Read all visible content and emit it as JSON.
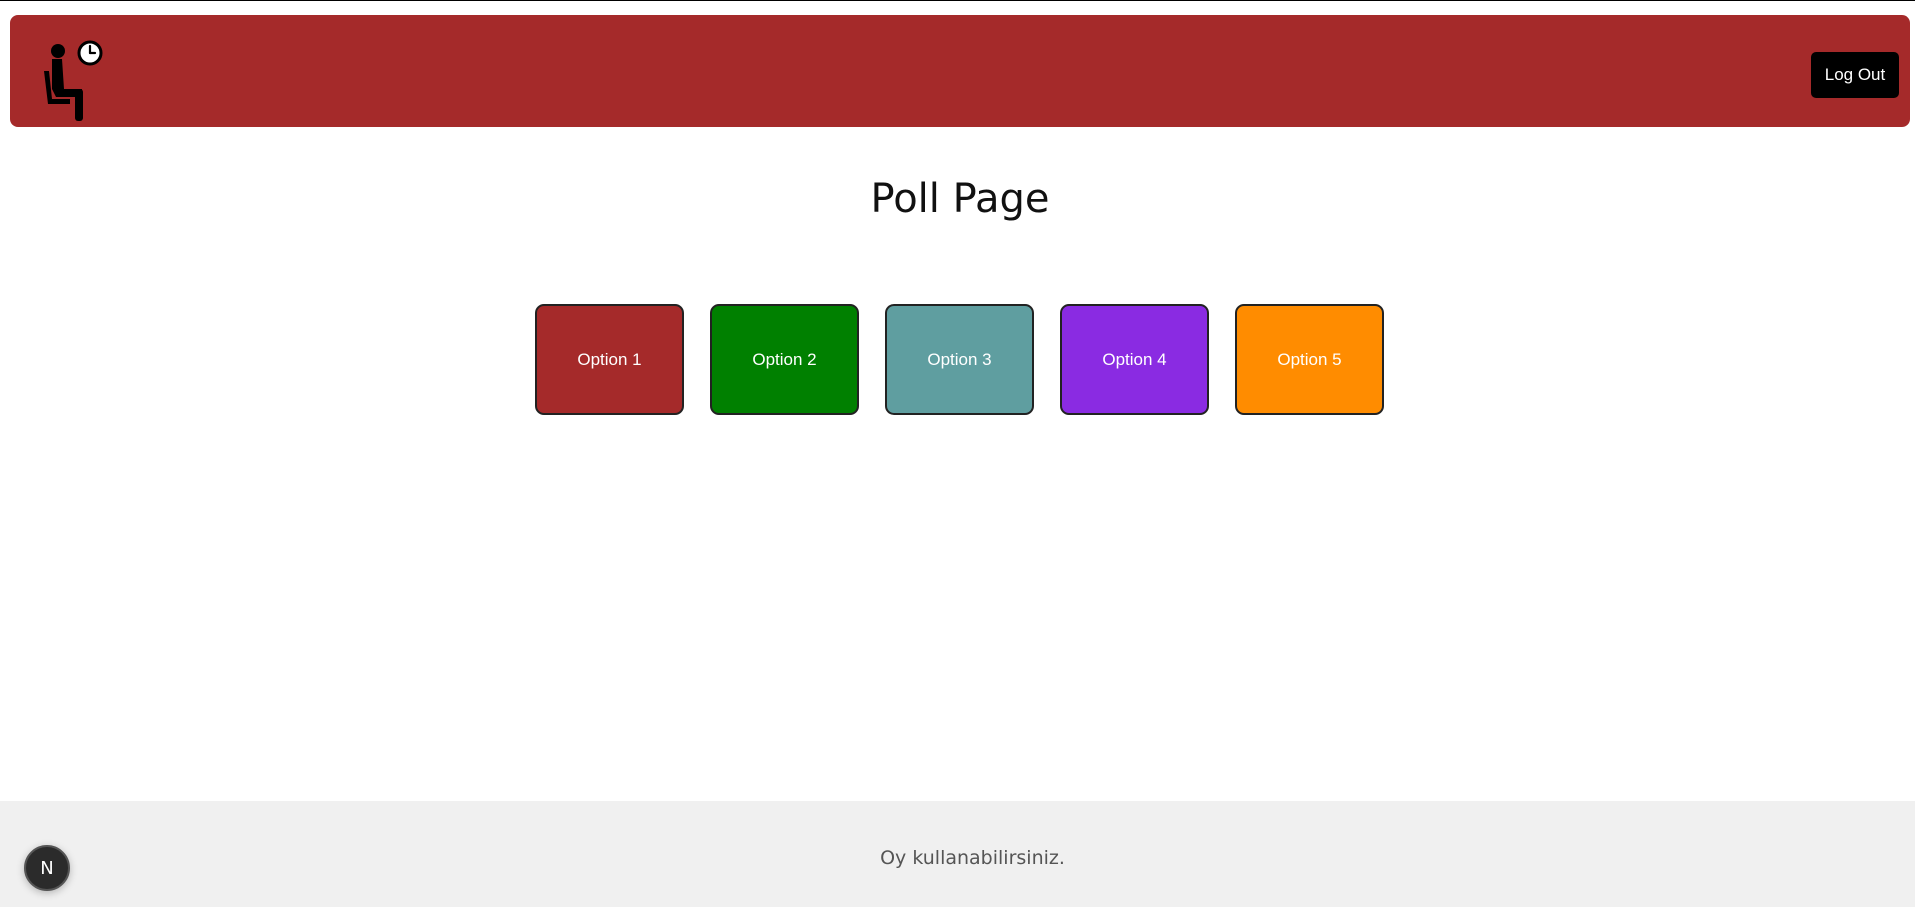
{
  "header": {
    "logo_icon": "waiting-person-with-clock-icon",
    "logout_label": "Log Out",
    "background": "#a52a2a"
  },
  "main": {
    "title": "Poll Page",
    "options": [
      {
        "label": "Option 1",
        "color": "#a52a2a"
      },
      {
        "label": "Option 2",
        "color": "#008000"
      },
      {
        "label": "Option 3",
        "color": "#5f9ea0"
      },
      {
        "label": "Option 4",
        "color": "#8a2be2"
      },
      {
        "label": "Option 5",
        "color": "#ff8c00"
      }
    ]
  },
  "footer": {
    "text": "Oy kullanabilirsiniz."
  },
  "dev_badge": {
    "label": "N",
    "icon": "nextjs-icon"
  }
}
